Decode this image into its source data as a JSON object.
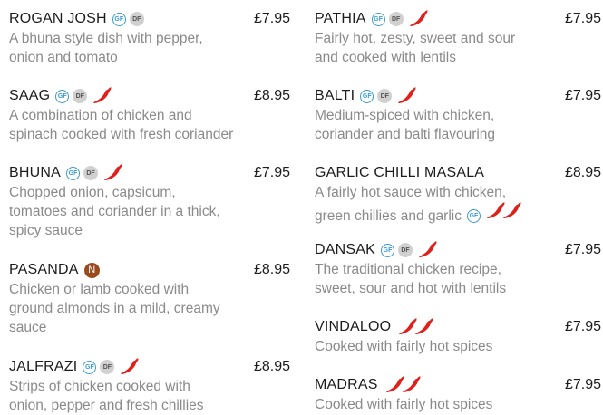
{
  "badges": {
    "gf": "GF",
    "df": "DF",
    "nut": "N"
  },
  "left": [
    {
      "name": "ROGAN JOSH",
      "price": "£7.95",
      "desc": [
        "A bhuna style dish with pepper,",
        "onion and tomato"
      ]
    },
    {
      "name": "SAAG",
      "price": "£8.95",
      "desc": [
        "A combination of chicken and",
        "spinach cooked with fresh coriander"
      ]
    },
    {
      "name": "BHUNA",
      "price": "£7.95",
      "desc": [
        "Chopped onion, capsicum,",
        "tomatoes and coriander in a thick,",
        "spicy sauce"
      ]
    },
    {
      "name": "PASANDA",
      "price": "£8.95",
      "desc": [
        "Chicken or lamb cooked with",
        "ground almonds in a mild, creamy",
        "sauce"
      ]
    },
    {
      "name": "JALFRAZI",
      "price": "£8.95",
      "desc": [
        "Strips of chicken cooked with",
        "onion, pepper and fresh chillies"
      ]
    }
  ],
  "right": [
    {
      "name": "PATHIA",
      "price": "£7.95",
      "desc": [
        "Fairly hot, zesty, sweet and sour",
        "and cooked with lentils"
      ]
    },
    {
      "name": "BALTI",
      "price": "£7.95",
      "desc": [
        "Medium-spiced with chicken,",
        "coriander and balti flavouring"
      ]
    },
    {
      "name": "GARLIC CHILLI MASALA",
      "price": "£8.95",
      "desc": [
        "A fairly hot sauce with chicken,",
        "green chillies and garlic"
      ]
    },
    {
      "name": "DANSAK",
      "price": "£7.95",
      "desc": [
        "The traditional chicken recipe,",
        "sweet, sour and hot with lentils"
      ]
    },
    {
      "name": "VINDALOO",
      "price": "£7.95",
      "desc": [
        "Cooked with fairly hot spices"
      ]
    },
    {
      "name": "MADRAS",
      "price": "£7.95",
      "desc": [
        "Cooked with fairly hot spices"
      ]
    }
  ],
  "colors": {
    "chilli": "#e0201a",
    "gf": "#3a9bd1",
    "nut": "#9b4a1e",
    "text": "#1c1c1c",
    "desc": "#8a8a8a"
  },
  "icons": {
    "chilli": "chilli-icon",
    "gf": "gluten-free-icon",
    "df": "dairy-free-icon",
    "nut": "nut-icon"
  }
}
